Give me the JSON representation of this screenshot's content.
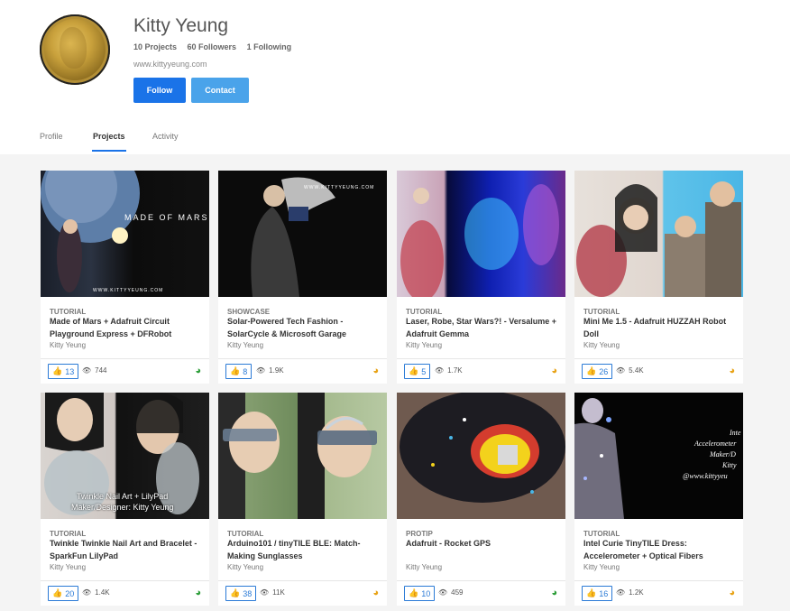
{
  "profile": {
    "name": "Kitty Yeung",
    "projects": "10 Projects",
    "followers": "60 Followers",
    "following": "1 Following",
    "website": "www.kittyyeung.com",
    "follow_label": "Follow",
    "contact_label": "Contact"
  },
  "tabs": [
    {
      "label": "Profile"
    },
    {
      "label": "Projects"
    },
    {
      "label": "Activity"
    }
  ],
  "cards": [
    {
      "category": "TUTORIAL",
      "title": "Made of Mars + Adafruit Circuit Playground Express + DFRobot",
      "author": "Kitty Yeung",
      "likes": "13",
      "views": "744",
      "status_color": "#2e9e3a",
      "thumb_caption": "MADE OF MARS",
      "thumb_caption2": "WWW.KITTYYEUNG.COM"
    },
    {
      "category": "SHOWCASE",
      "title": "Solar-Powered Tech Fashion - SolarCycle & Microsoft Garage",
      "author": "Kitty Yeung",
      "likes": "8",
      "views": "1.9K",
      "status_color": "#e8a317",
      "thumb_caption": "WWW.KITTYYEUNG.COM"
    },
    {
      "category": "TUTORIAL",
      "title": "Laser, Robe, Star Wars?! - Versalume + Adafruit Gemma",
      "author": "Kitty Yeung",
      "likes": "5",
      "views": "1.7K",
      "status_color": "#e8a317"
    },
    {
      "category": "TUTORIAL",
      "title": "Mini Me 1.5 - Adafruit HUZZAH Robot Doll",
      "author": "Kitty Yeung",
      "likes": "26",
      "views": "5.4K",
      "status_color": "#e8a317"
    },
    {
      "category": "TUTORIAL",
      "title": "Twinkle Twinkle Nail Art and Bracelet - SparkFun LilyPad",
      "author": "Kitty Yeung",
      "likes": "20",
      "views": "1.4K",
      "status_color": "#2e9e3a",
      "thumb_caption": "Twinkle Nail Art + LilyPad",
      "thumb_caption2": "Maker/Designer: Kitty Yeung"
    },
    {
      "category": "TUTORIAL",
      "title": "Arduino101 / tinyTILE BLE: Match-Making Sunglasses",
      "author": "Kitty Yeung",
      "likes": "38",
      "views": "11K",
      "status_color": "#e8a317"
    },
    {
      "category": "PROTIP",
      "title": "Adafruit - Rocket GPS",
      "author": "Kitty Yeung",
      "likes": "10",
      "views": "459",
      "status_color": "#2e9e3a"
    },
    {
      "category": "TUTORIAL",
      "title": "Intel Curie TinyTILE Dress: Accelerometer + Optical Fibers",
      "author": "Kitty Yeung",
      "likes": "16",
      "views": "1.2K",
      "status_color": "#e8a317",
      "thumb_caption": "Inte",
      "thumb_caption2": "Accelerometer",
      "thumb_caption3": "Maker/D",
      "thumb_caption4": "Kitty",
      "thumb_caption5": "@www.kittyyeu"
    }
  ],
  "icons": {
    "like": "thumbs-up-icon",
    "views": "eye-icon",
    "status": "respect-gauge-icon"
  }
}
